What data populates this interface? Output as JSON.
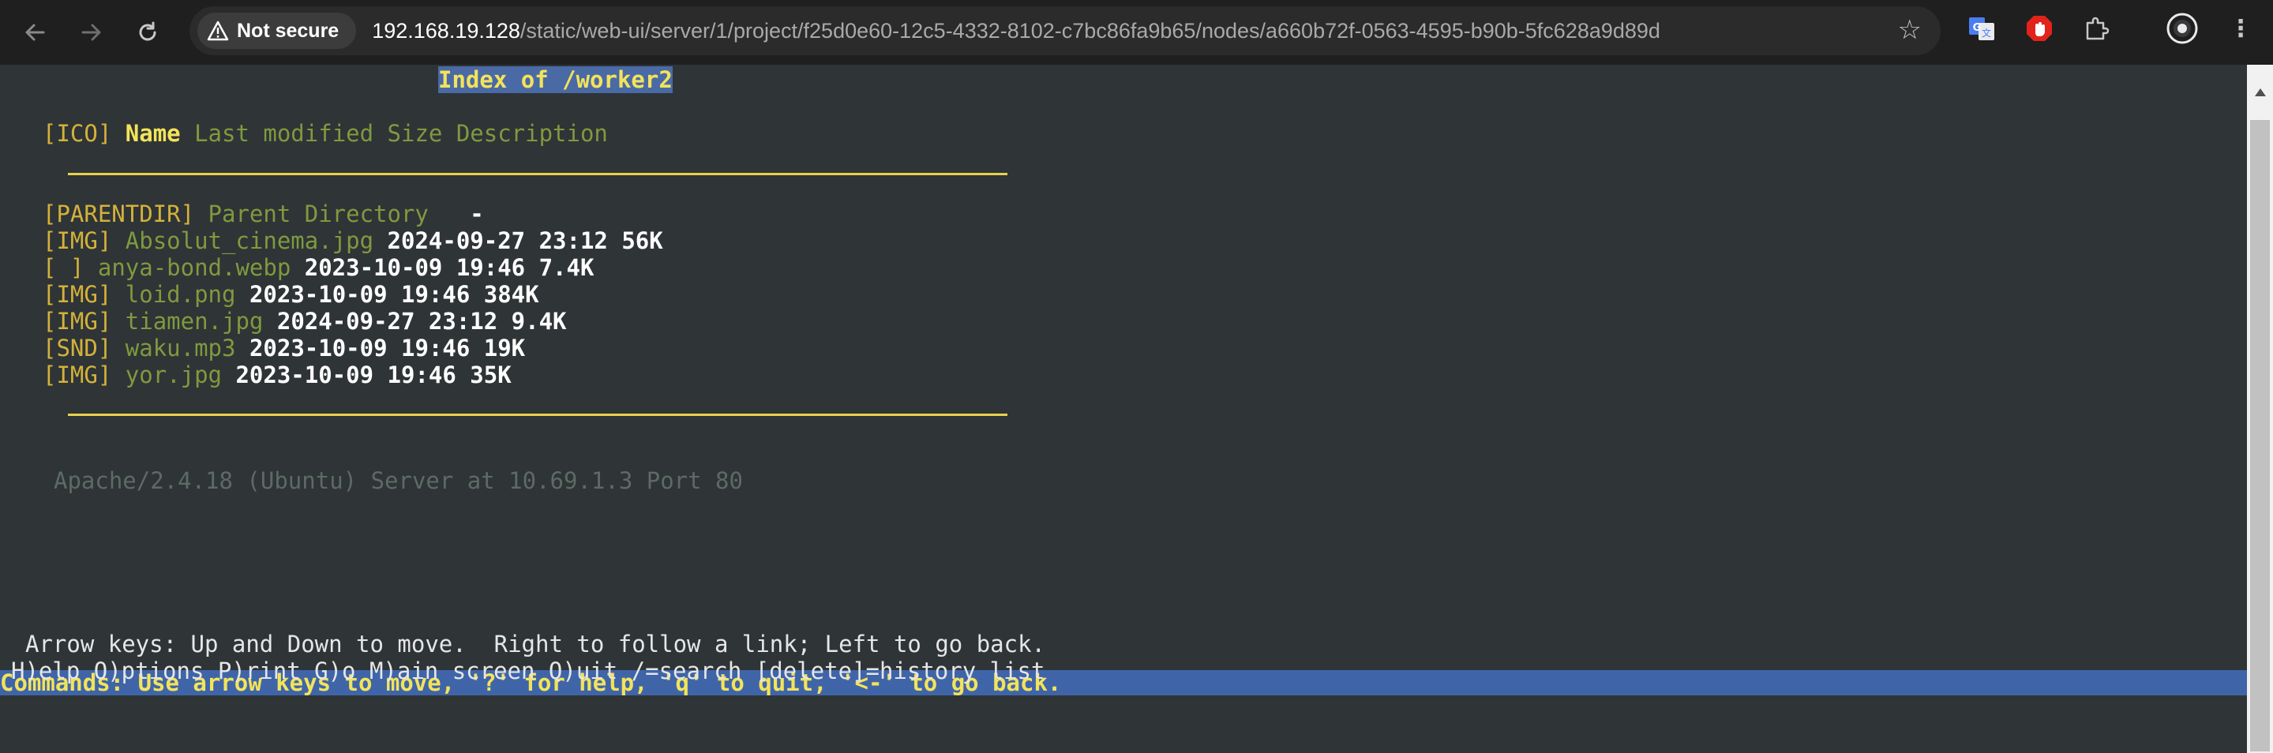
{
  "browser": {
    "security_label": "Not secure",
    "url_host": "192.168.19.128",
    "url_path": "/static/web-ui/server/1/project/f25d0e60-12c5-4332-8102-c7bc86fa9b65/nodes/a660b72f-0563-4595-b90b-5fc628a9d89d",
    "icons": [
      "back-icon",
      "forward-icon",
      "reload-icon",
      "warning-icon",
      "star-icon",
      "translate-icon",
      "adblock-icon",
      "puzzle-icon",
      "profile-icon",
      "menu-icon"
    ]
  },
  "page": {
    "title": "Index of /worker2",
    "header": {
      "ico": "[ICO]",
      "name": "Name",
      "rest": "Last modified Size Description"
    },
    "parent": {
      "tag": "[PARENTDIR]",
      "name": "Parent Directory",
      "size": "-"
    },
    "files": [
      {
        "tag": "[IMG]",
        "name": "Absolut_cinema.jpg",
        "info": "2024-09-27 23:12 56K"
      },
      {
        "tag": "[ ]",
        "name": "anya-bond.webp",
        "info": "2023-10-09 19:46 7.4K"
      },
      {
        "tag": "[IMG]",
        "name": "loid.png",
        "info": "2023-10-09 19:46 384K"
      },
      {
        "tag": "[IMG]",
        "name": "tiamen.jpg",
        "info": "2024-09-27 23:12 9.4K"
      },
      {
        "tag": "[SND]",
        "name": "waku.mp3",
        "info": "2023-10-09 19:46 19K"
      },
      {
        "tag": "[IMG]",
        "name": "yor.jpg",
        "info": "2023-10-09 19:46 35K"
      }
    ],
    "footer": "Apache/2.4.18 (Ubuntu) Server at 10.69.1.3 Port 80"
  },
  "lynx": {
    "commands": "Commands: Use arrow keys to move, '?' for help, 'q' to quit, '<-' to go back.",
    "arrow_help": "Arrow keys: Up and Down to move.  Right to follow a link; Left to go back.",
    "menu_help": "H)elp O)ptions P)rint G)o M)ain screen Q)uit /=search [delete]=history list"
  },
  "colors": {
    "background": "#2f3437",
    "link": "#7f9a3e",
    "tag": "#d3b23a",
    "highlight": "#3f65a8",
    "rule": "#e8d04e"
  }
}
